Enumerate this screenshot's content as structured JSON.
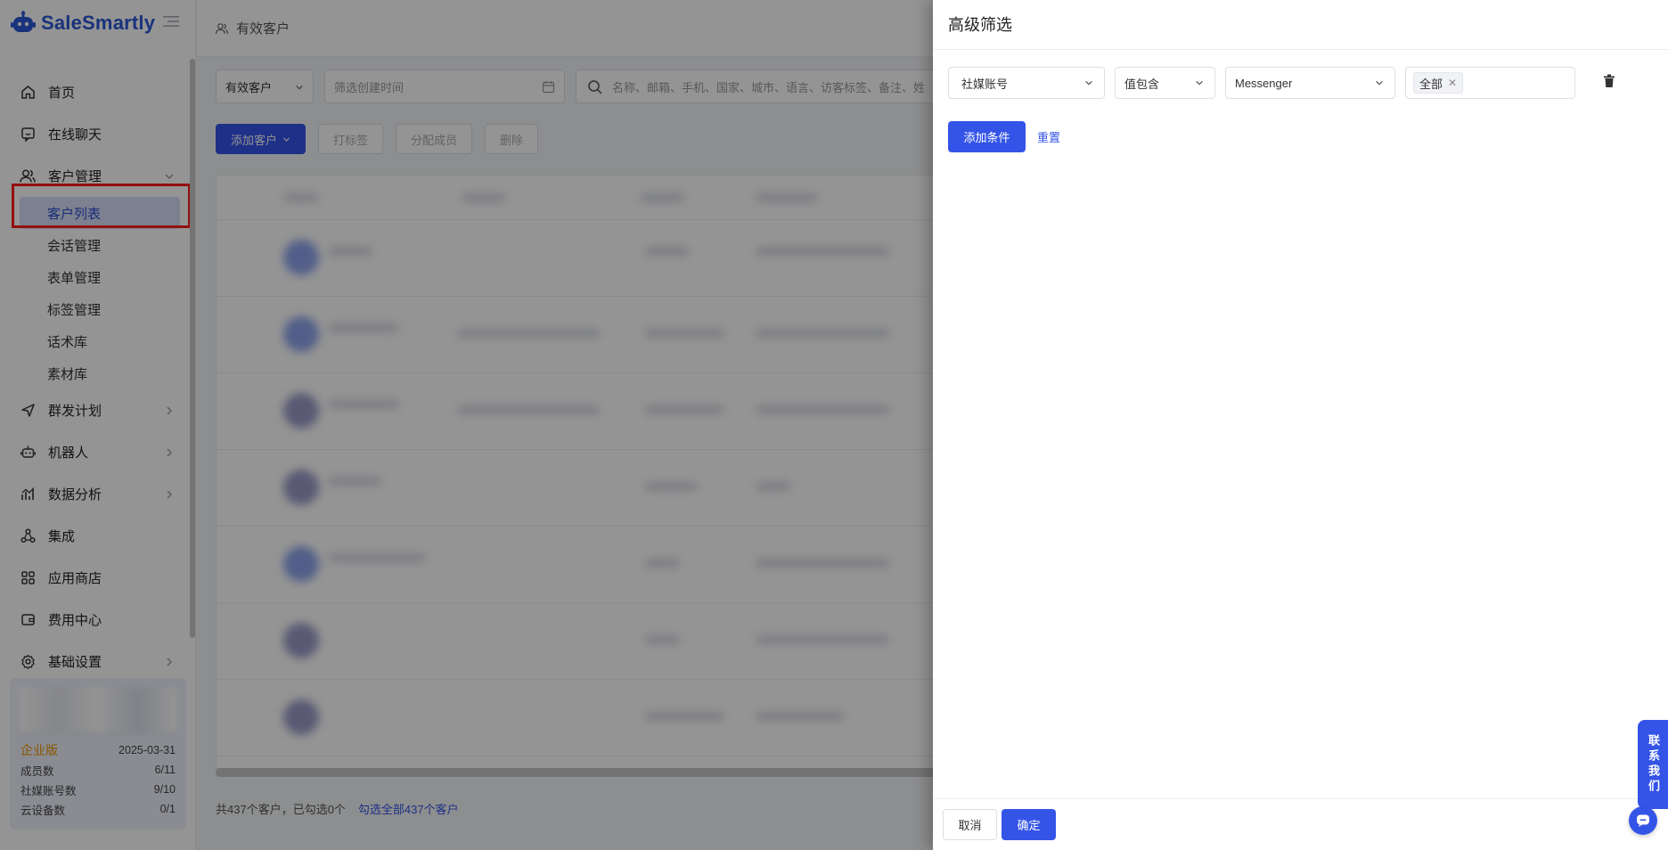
{
  "app": {
    "brand": "SaleSmartly"
  },
  "sidebar": {
    "items": [
      {
        "label": "首页",
        "icon": "home-icon"
      },
      {
        "label": "在线聊天",
        "icon": "chat-icon"
      },
      {
        "label": "客户管理",
        "icon": "users-icon",
        "expanded": true,
        "children": [
          "客户列表",
          "会话管理",
          "表单管理",
          "标签管理",
          "话术库",
          "素材库"
        ],
        "active_child": "客户列表"
      },
      {
        "label": "群发计划",
        "icon": "send-icon"
      },
      {
        "label": "机器人",
        "icon": "robot-icon"
      },
      {
        "label": "数据分析",
        "icon": "chart-icon"
      },
      {
        "label": "集成",
        "icon": "integration-icon"
      },
      {
        "label": "应用商店",
        "icon": "apps-icon"
      },
      {
        "label": "费用中心",
        "icon": "wallet-icon"
      },
      {
        "label": "基础设置",
        "icon": "gear-icon"
      }
    ],
    "plan": {
      "edition": "企业版",
      "expiry": "2025-03-31",
      "rows": [
        {
          "label": "成员数",
          "value": "6/11"
        },
        {
          "label": "社媒账号数",
          "value": "9/10"
        },
        {
          "label": "云设备数",
          "value": "0/1"
        }
      ]
    }
  },
  "main": {
    "breadcrumb": "有效客户",
    "filters": {
      "segment": "有效客户",
      "date_placeholder": "筛选创建时间",
      "search_placeholder": "名称、邮箱、手机、国家、城市、语言、访客标签、备注、姓"
    },
    "actions": [
      "添加客户",
      "打标签",
      "分配成员",
      "删除"
    ],
    "footer": {
      "summary": "共437个客户，已勾选0个",
      "select_all": "勾选全部437个客户"
    }
  },
  "drawer": {
    "title": "高级筛选",
    "condition": {
      "field": "社媒账号",
      "operator": "值包含",
      "value": "Messenger",
      "tag": "全部"
    },
    "add_condition_label": "添加条件",
    "reset_label": "重置",
    "cancel_label": "取消",
    "confirm_label": "确定"
  },
  "contact": {
    "label": "联系我们"
  },
  "colors": {
    "primary": "#3454e8",
    "active_bg": "#d6dcf7",
    "highlight": "#ff1a1a",
    "edition": "#f09500"
  }
}
